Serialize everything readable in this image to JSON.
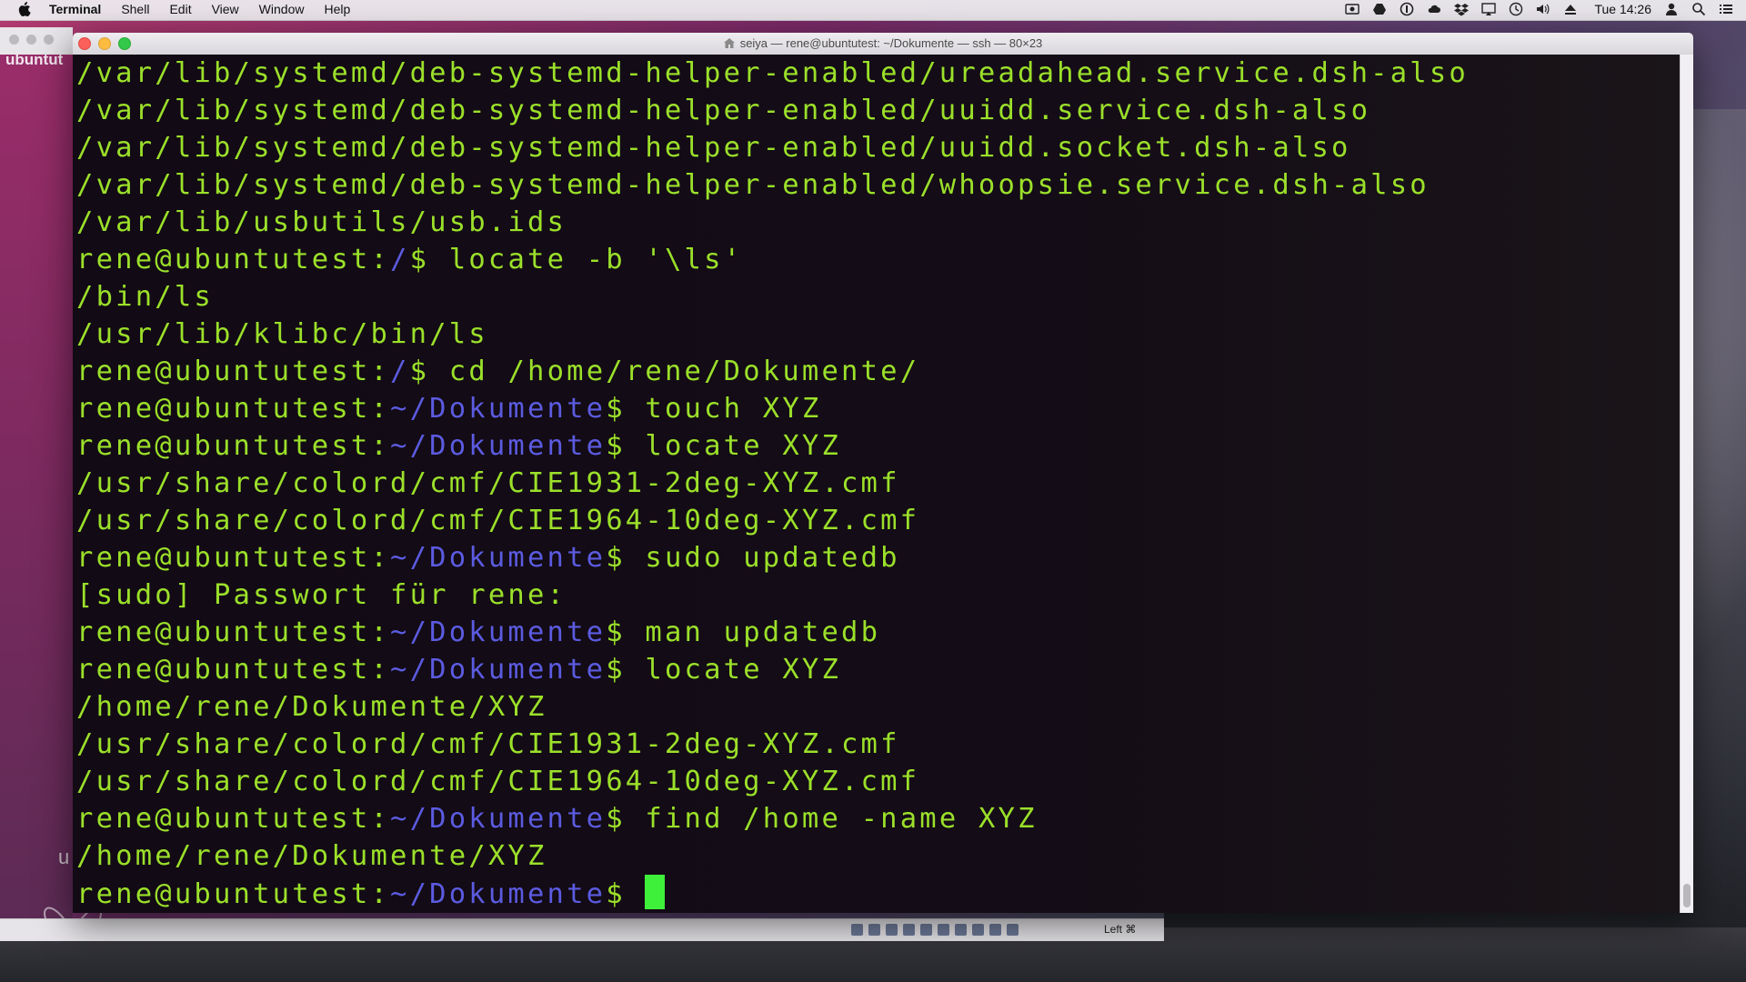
{
  "menubar": {
    "app_name": "Terminal",
    "menus": [
      "Shell",
      "Edit",
      "View",
      "Window",
      "Help"
    ],
    "status_icons": [
      "screen-record-icon",
      "google-drive-icon",
      "1password-icon",
      "cloud-icon",
      "dropbox-icon",
      "screen-mirroring-icon",
      "time-machine-icon",
      "volume-icon",
      "eject-icon"
    ],
    "clock": "Tue 14:26"
  },
  "desktop": {
    "vm_label": "ubuntut",
    "vm_letter": "u"
  },
  "window": {
    "title": "seiya — rene@ubuntutest: ~/Dokumente — ssh — 80×23"
  },
  "terminal": {
    "lines": [
      {
        "type": "output",
        "text": "/var/lib/systemd/deb-systemd-helper-enabled/ureadahead.service.dsh-also"
      },
      {
        "type": "output",
        "text": "/var/lib/systemd/deb-systemd-helper-enabled/uuidd.service.dsh-also"
      },
      {
        "type": "output",
        "text": "/var/lib/systemd/deb-systemd-helper-enabled/uuidd.socket.dsh-also"
      },
      {
        "type": "output",
        "text": "/var/lib/systemd/deb-systemd-helper-enabled/whoopsie.service.dsh-also"
      },
      {
        "type": "output",
        "text": "/var/lib/usbutils/usb.ids"
      },
      {
        "type": "prompt",
        "host": "rene@ubuntutest",
        "path": "/",
        "cmd": " locate -b '\\ls'"
      },
      {
        "type": "output",
        "text": "/bin/ls"
      },
      {
        "type": "output",
        "text": "/usr/lib/klibc/bin/ls"
      },
      {
        "type": "prompt",
        "host": "rene@ubuntutest",
        "path": "/",
        "cmd": " cd /home/rene/Dokumente/"
      },
      {
        "type": "prompt",
        "host": "rene@ubuntutest",
        "path": "~/Dokumente",
        "cmd": " touch XYZ"
      },
      {
        "type": "prompt",
        "host": "rene@ubuntutest",
        "path": "~/Dokumente",
        "cmd": " locate XYZ"
      },
      {
        "type": "output",
        "text": "/usr/share/colord/cmf/CIE1931-2deg-XYZ.cmf"
      },
      {
        "type": "output",
        "text": "/usr/share/colord/cmf/CIE1964-10deg-XYZ.cmf"
      },
      {
        "type": "prompt",
        "host": "rene@ubuntutest",
        "path": "~/Dokumente",
        "cmd": " sudo updatedb"
      },
      {
        "type": "output",
        "text": "[sudo] Passwort für rene:"
      },
      {
        "type": "prompt",
        "host": "rene@ubuntutest",
        "path": "~/Dokumente",
        "cmd": " man updatedb"
      },
      {
        "type": "prompt",
        "host": "rene@ubuntutest",
        "path": "~/Dokumente",
        "cmd": " locate XYZ"
      },
      {
        "type": "output",
        "text": "/home/rene/Dokumente/XYZ"
      },
      {
        "type": "output",
        "text": "/usr/share/colord/cmf/CIE1931-2deg-XYZ.cmf"
      },
      {
        "type": "output",
        "text": "/usr/share/colord/cmf/CIE1964-10deg-XYZ.cmf"
      },
      {
        "type": "prompt",
        "host": "rene@ubuntutest",
        "path": "~/Dokumente",
        "cmd": " find /home -name XYZ"
      },
      {
        "type": "output",
        "text": "/home/rene/Dokumente/XYZ"
      },
      {
        "type": "prompt",
        "host": "rene@ubuntutest",
        "path": "~/Dokumente",
        "cmd": " ",
        "cursor": true
      }
    ]
  },
  "vbox_status": {
    "host_key": "Left ⌘"
  },
  "colors": {
    "terminal_text": "#9be02a",
    "prompt_path": "#5b5be0",
    "cursor": "#3ff03a",
    "terminal_bg": "#120c15"
  }
}
